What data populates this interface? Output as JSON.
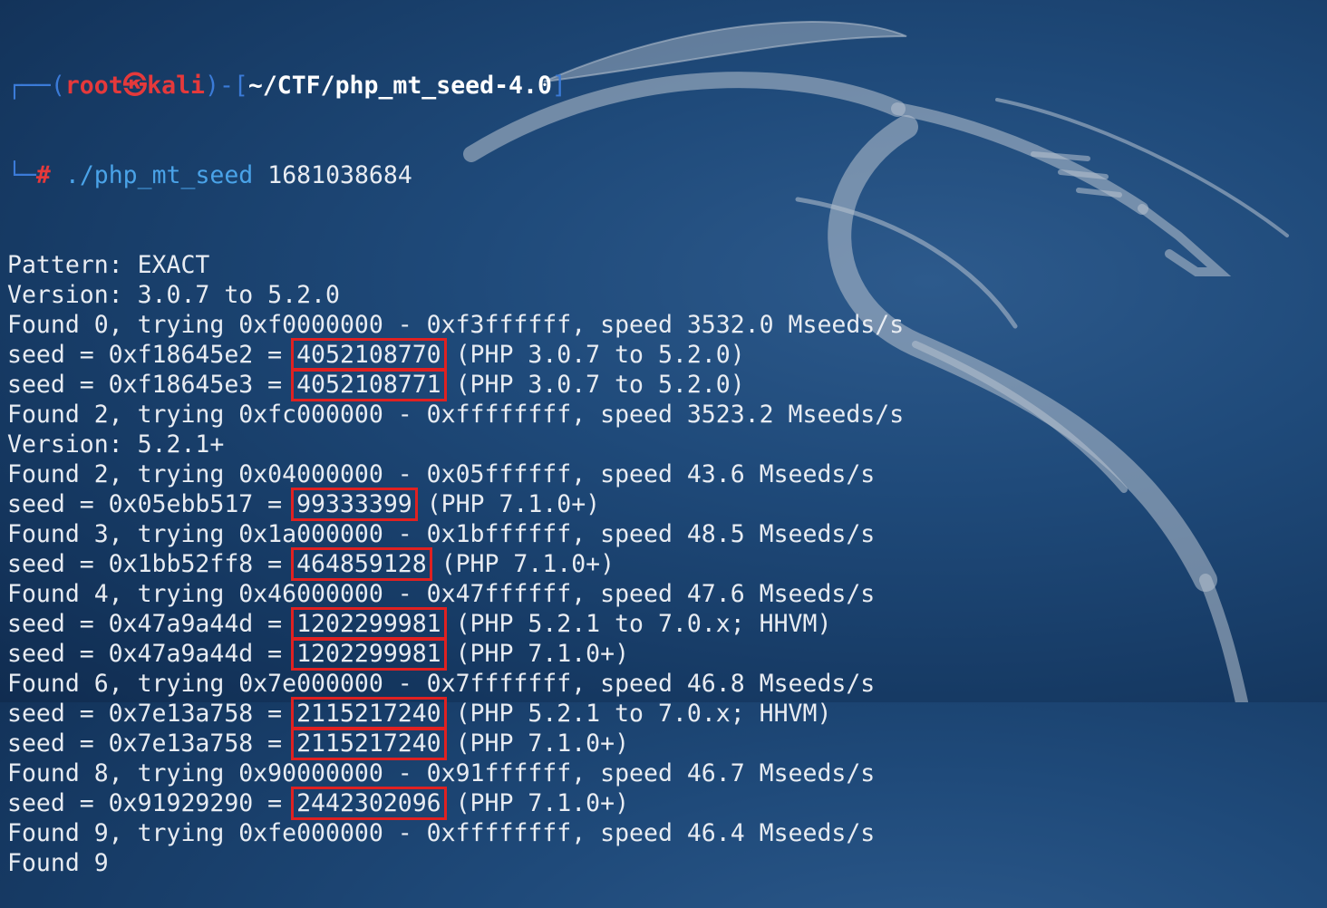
{
  "prompt": {
    "box_top": "┌──(",
    "user": "root",
    "skull": "㉿",
    "host": "kali",
    "mid": ")-[",
    "path": "~/CTF/php_mt_seed-4.0",
    "close": "]",
    "box_bottom": "└─",
    "hash": "#",
    "command": "./php_mt_seed",
    "argument": "1681038684"
  },
  "lines": [
    {
      "type": "text",
      "text": "Pattern: EXACT"
    },
    {
      "type": "text",
      "text": "Version: 3.0.7 to 5.2.0"
    },
    {
      "type": "text",
      "text": "Found 0, trying 0xf0000000 - 0xf3ffffff, speed 3532.0 Mseeds/s"
    },
    {
      "type": "seed",
      "prefix": "seed = 0xf18645e2 = ",
      "value": "4052108770",
      "suffix": " (PHP 3.0.7 to 5.2.0)"
    },
    {
      "type": "seed",
      "prefix": "seed = 0xf18645e3 = ",
      "value": "4052108771",
      "suffix": " (PHP 3.0.7 to 5.2.0)"
    },
    {
      "type": "text",
      "text": "Found 2, trying 0xfc000000 - 0xffffffff, speed 3523.2 Mseeds/s"
    },
    {
      "type": "text",
      "text": "Version: 5.2.1+"
    },
    {
      "type": "text",
      "text": "Found 2, trying 0x04000000 - 0x05ffffff, speed 43.6 Mseeds/s"
    },
    {
      "type": "seed",
      "prefix": "seed = 0x05ebb517 = ",
      "value": "99333399",
      "suffix": " (PHP 7.1.0+)"
    },
    {
      "type": "text",
      "text": "Found 3, trying 0x1a000000 - 0x1bffffff, speed 48.5 Mseeds/s"
    },
    {
      "type": "seed",
      "prefix": "seed = 0x1bb52ff8 = ",
      "value": "464859128",
      "suffix": " (PHP 7.1.0+)"
    },
    {
      "type": "text",
      "text": "Found 4, trying 0x46000000 - 0x47ffffff, speed 47.6 Mseeds/s"
    },
    {
      "type": "seed",
      "prefix": "seed = 0x47a9a44d = ",
      "value": "1202299981",
      "suffix": " (PHP 5.2.1 to 7.0.x; HHVM)"
    },
    {
      "type": "seed",
      "prefix": "seed = 0x47a9a44d = ",
      "value": "1202299981",
      "suffix": " (PHP 7.1.0+)"
    },
    {
      "type": "text",
      "text": "Found 6, trying 0x7e000000 - 0x7fffffff, speed 46.8 Mseeds/s"
    },
    {
      "type": "seed",
      "prefix": "seed = 0x7e13a758 = ",
      "value": "2115217240",
      "suffix": " (PHP 5.2.1 to 7.0.x; HHVM)"
    },
    {
      "type": "seed",
      "prefix": "seed = 0x7e13a758 = ",
      "value": "2115217240",
      "suffix": " (PHP 7.1.0+)"
    },
    {
      "type": "text",
      "text": "Found 8, trying 0x90000000 - 0x91ffffff, speed 46.7 Mseeds/s"
    },
    {
      "type": "seed",
      "prefix": "seed = 0x91929290 = ",
      "value": "2442302096",
      "suffix": " (PHP 7.1.0+)"
    },
    {
      "type": "text",
      "text": "Found 9, trying 0xfe000000 - 0xffffffff, speed 46.4 Mseeds/s"
    },
    {
      "type": "text",
      "text": "Found 9"
    }
  ],
  "colors": {
    "background": "#1f4a7a",
    "text": "#e8ecf2",
    "prompt_root": "#e5393b",
    "prompt_box": "#3b7bd8",
    "command": "#4aa3e8",
    "highlight_box": "#e02121"
  },
  "icons": {
    "background_logo": "kali-dragon-icon"
  }
}
